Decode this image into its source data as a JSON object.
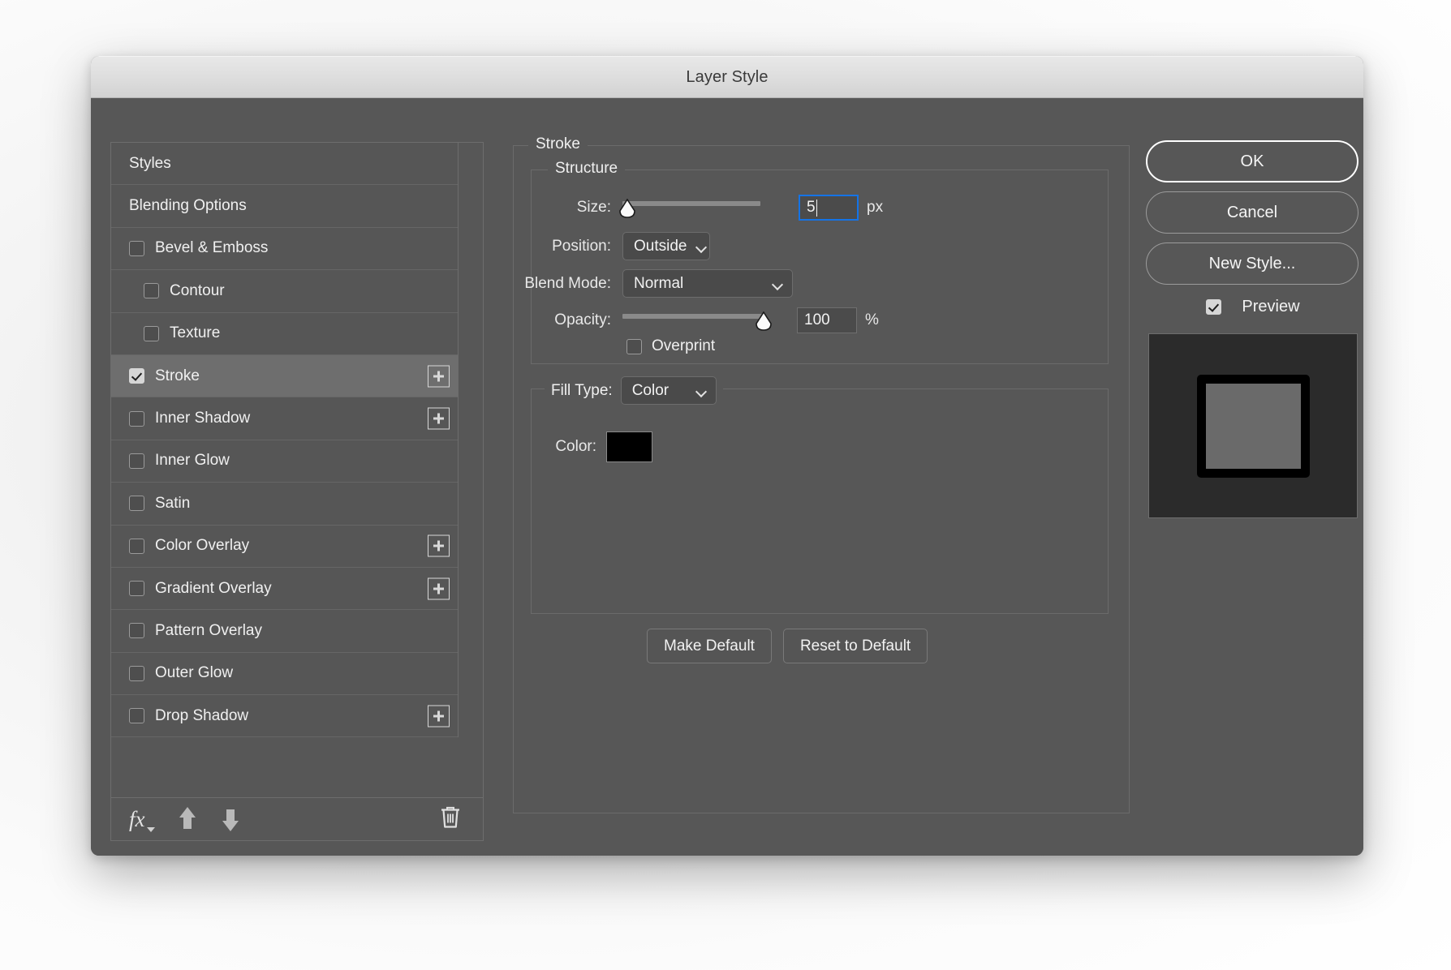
{
  "window": {
    "title": "Layer Style"
  },
  "sidebar": {
    "items": [
      {
        "label": "Styles",
        "type": "plain",
        "indent": 0,
        "checked": false,
        "selected": false,
        "plus": false
      },
      {
        "label": "Blending Options",
        "type": "plain",
        "indent": 0,
        "checked": false,
        "selected": false,
        "plus": false
      },
      {
        "label": "Bevel & Emboss",
        "type": "check",
        "indent": 0,
        "checked": false,
        "selected": false,
        "plus": false
      },
      {
        "label": "Contour",
        "type": "check",
        "indent": 1,
        "checked": false,
        "selected": false,
        "plus": false
      },
      {
        "label": "Texture",
        "type": "check",
        "indent": 1,
        "checked": false,
        "selected": false,
        "plus": false
      },
      {
        "label": "Stroke",
        "type": "check",
        "indent": 0,
        "checked": true,
        "selected": true,
        "plus": true
      },
      {
        "label": "Inner Shadow",
        "type": "check",
        "indent": 0,
        "checked": false,
        "selected": false,
        "plus": true
      },
      {
        "label": "Inner Glow",
        "type": "check",
        "indent": 0,
        "checked": false,
        "selected": false,
        "plus": false
      },
      {
        "label": "Satin",
        "type": "check",
        "indent": 0,
        "checked": false,
        "selected": false,
        "plus": false
      },
      {
        "label": "Color Overlay",
        "type": "check",
        "indent": 0,
        "checked": false,
        "selected": false,
        "plus": true
      },
      {
        "label": "Gradient Overlay",
        "type": "check",
        "indent": 0,
        "checked": false,
        "selected": false,
        "plus": true
      },
      {
        "label": "Pattern Overlay",
        "type": "check",
        "indent": 0,
        "checked": false,
        "selected": false,
        "plus": false
      },
      {
        "label": "Outer Glow",
        "type": "check",
        "indent": 0,
        "checked": false,
        "selected": false,
        "plus": false
      },
      {
        "label": "Drop Shadow",
        "type": "check",
        "indent": 0,
        "checked": false,
        "selected": false,
        "plus": true
      }
    ],
    "toolbar": {
      "fx_label": "fx",
      "move_up": "move-effect-up",
      "move_down": "move-effect-down",
      "delete": "delete-effect"
    }
  },
  "main": {
    "group_title": "Stroke",
    "structure": {
      "title": "Structure",
      "size": {
        "label": "Size:",
        "value": "5",
        "unit": "px",
        "slider_percent": 3,
        "track_fill_percent": 88
      },
      "position": {
        "label": "Position:",
        "value": "Outside"
      },
      "blend_mode": {
        "label": "Blend Mode:",
        "value": "Normal"
      },
      "opacity": {
        "label": "Opacity:",
        "value": "100",
        "unit": "%",
        "slider_percent": 100
      },
      "overprint": {
        "label": "Overprint",
        "checked": false
      }
    },
    "fill": {
      "fill_type_label": "Fill Type:",
      "fill_type_value": "Color",
      "color_label": "Color:",
      "color_value": "#000000"
    },
    "buttons": {
      "make_default": "Make Default",
      "reset_to_default": "Reset to Default"
    }
  },
  "actions": {
    "ok": "OK",
    "cancel": "Cancel",
    "new_style": "New Style...",
    "preview_label": "Preview",
    "preview_checked": true
  },
  "colors": {
    "dialog_bg": "#575757",
    "row_bg": "#565656",
    "row_selected_bg": "#6e6e6e",
    "focus_blue": "#1473e6",
    "text": "#f0f0f0",
    "preview_bg": "#2b2b2b",
    "preview_stroke": "#000000",
    "preview_fill": "#6a6a6a"
  }
}
